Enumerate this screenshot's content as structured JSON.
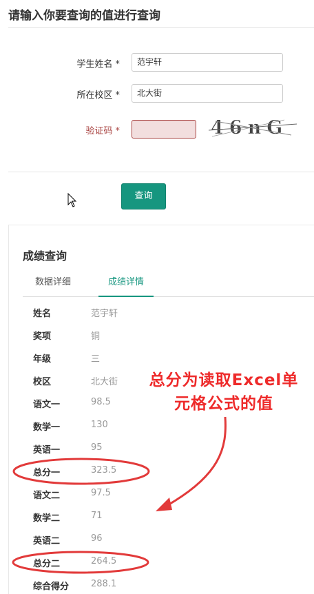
{
  "page": {
    "title": "请输入你要查询的值进行查询"
  },
  "form": {
    "name_label": "学生姓名",
    "name_value": "范宇轩",
    "campus_label": "所在校区",
    "campus_value": "北大街",
    "captcha_label": "验证码",
    "required_mark": "*",
    "captcha_text": "46nG",
    "query_button": "查询"
  },
  "result": {
    "title": "成绩查询",
    "tabs": [
      "数据详细",
      "成绩详情"
    ],
    "active_tab": "成绩详情",
    "rows": [
      {
        "key": "姓名",
        "value": "范宇轩"
      },
      {
        "key": "奖项",
        "value": "铜"
      },
      {
        "key": "年级",
        "value": "三"
      },
      {
        "key": "校区",
        "value": "北大街"
      },
      {
        "key": "语文一",
        "value": "98.5"
      },
      {
        "key": "数学一",
        "value": "130"
      },
      {
        "key": "英语一",
        "value": "95"
      },
      {
        "key": "总分一",
        "value": "323.5"
      },
      {
        "key": "语文二",
        "value": "97.5"
      },
      {
        "key": "数学二",
        "value": "71"
      },
      {
        "key": "英语二",
        "value": "96"
      },
      {
        "key": "总分二",
        "value": "264.5"
      },
      {
        "key": "综合得分",
        "value": "288.1"
      }
    ]
  },
  "annotation": {
    "line1": "总分为读取Excel单",
    "line2": "元格公式的值"
  },
  "colors": {
    "primary": "#16967f",
    "error": "#a94442",
    "error_bg": "#f2dede",
    "annotation": "#ee2a2a"
  }
}
